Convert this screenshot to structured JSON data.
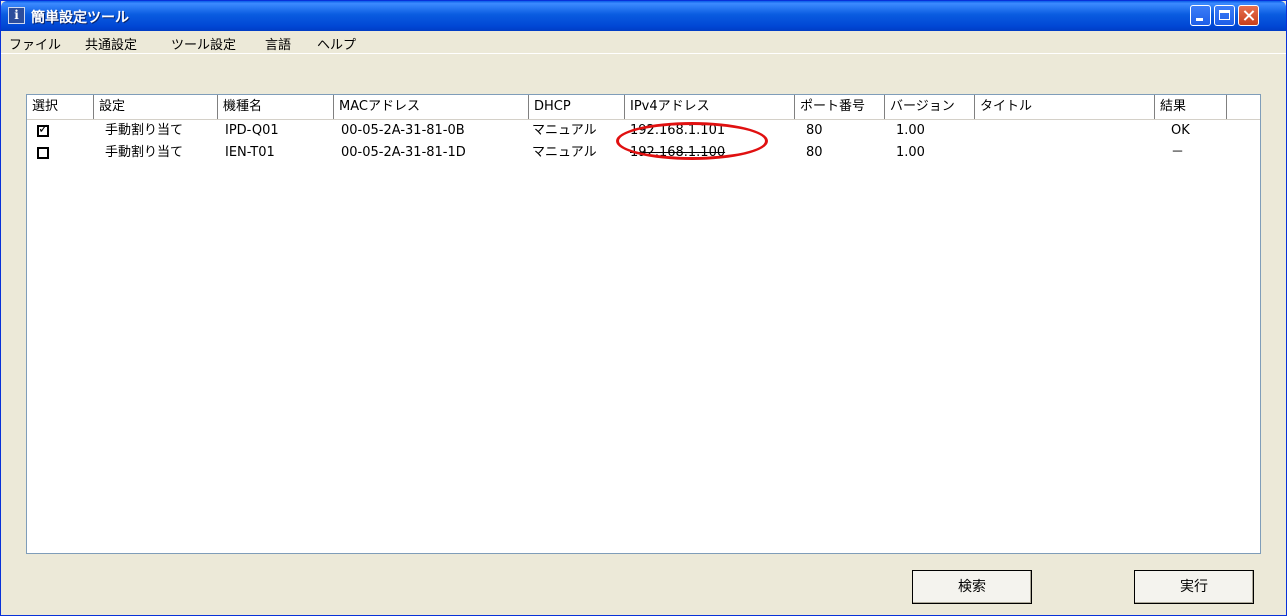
{
  "window": {
    "title": "簡単設定ツール",
    "app_icon_glyph": "i"
  },
  "menu": {
    "items": [
      "ファイル",
      "共通設定",
      "ツール設定",
      "言語",
      "ヘルプ"
    ]
  },
  "table": {
    "columns": [
      "選択",
      "設定",
      "機種名",
      "MACアドレス",
      "DHCP",
      "IPv4アドレス",
      "ポート番号",
      "バージョン",
      "タイトル",
      "結果"
    ],
    "rows": [
      {
        "selected": true,
        "setting": "手動割り当て",
        "model": "IPD-Q01",
        "mac": "00-05-2A-31-81-0B",
        "dhcp": "マニュアル",
        "ipv4": "192.168.1.101",
        "port": "80",
        "version": "1.00",
        "title": "",
        "result": "OK"
      },
      {
        "selected": false,
        "setting": "手動割り当て",
        "model": "IEN-T01",
        "mac": "00-05-2A-31-81-1D",
        "dhcp": "マニュアル",
        "ipv4": "192.168.1.100",
        "port": "80",
        "version": "1.00",
        "title": "",
        "result": "－"
      }
    ]
  },
  "buttons": {
    "search_label": "検索",
    "run_label": "実行"
  },
  "annotation": {
    "color": "#e01010"
  }
}
